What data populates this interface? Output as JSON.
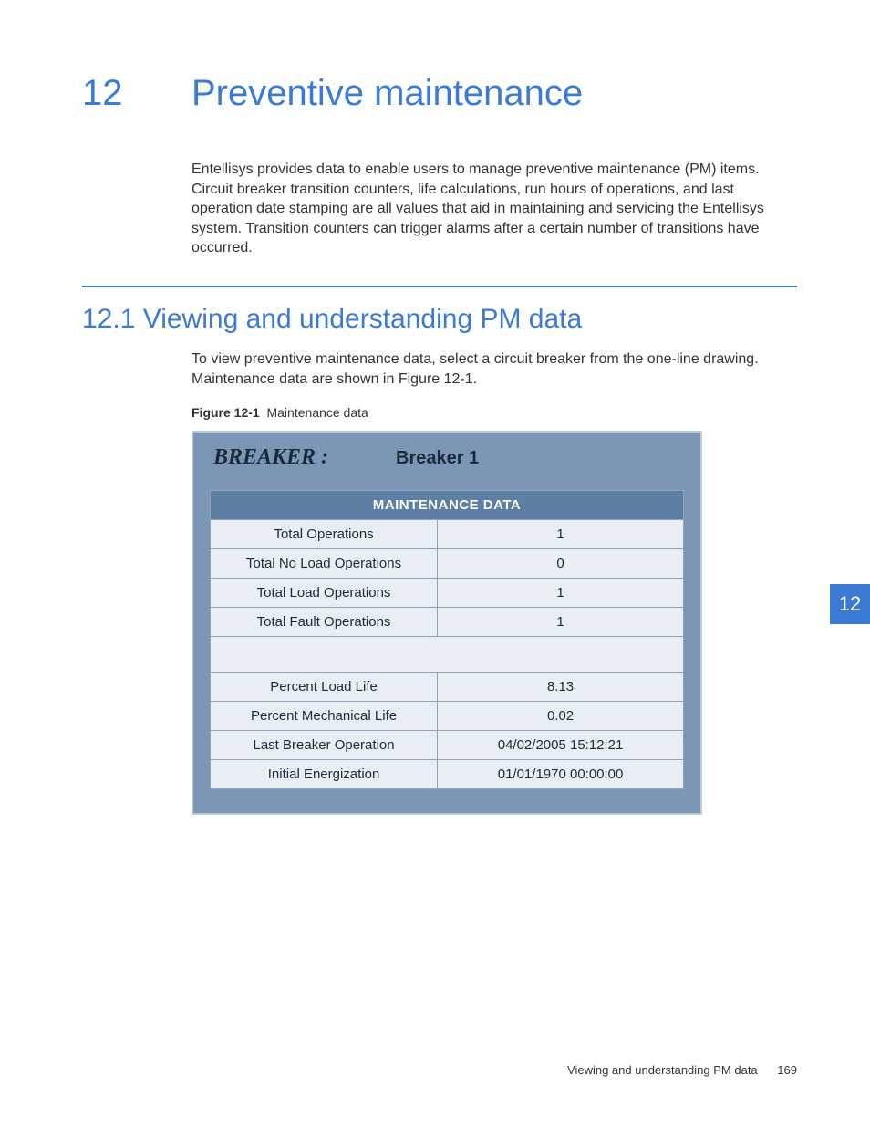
{
  "chapter": {
    "number": "12",
    "title": "Preventive maintenance"
  },
  "intro": "Entellisys provides data to enable users to manage preventive maintenance (PM) items. Circuit breaker transition counters, life calculations, run hours of operations, and last operation date stamping are all values that aid in maintaining and servicing the Entellisys system. Transition counters can trigger alarms after a certain number of transitions have occurred.",
  "section": {
    "number": "12.1",
    "title": "Viewing and understanding PM data",
    "body": "To view preventive maintenance data, select a circuit breaker from the one-line drawing. Maintenance data are shown in Figure 12-1."
  },
  "figure": {
    "label": "Figure 12-1",
    "caption": "Maintenance data"
  },
  "panel": {
    "breaker_label": "BREAKER :",
    "breaker_name": "Breaker 1",
    "table_header": "MAINTENANCE DATA",
    "rows1": [
      {
        "label": "Total Operations",
        "value": "1"
      },
      {
        "label": "Total No Load Operations",
        "value": "0"
      },
      {
        "label": "Total Load Operations",
        "value": "1"
      },
      {
        "label": "Total Fault Operations",
        "value": "1"
      }
    ],
    "rows2": [
      {
        "label": "Percent Load Life",
        "value": "8.13"
      },
      {
        "label": "Percent Mechanical Life",
        "value": "0.02"
      },
      {
        "label": "Last Breaker Operation",
        "value": "04/02/2005 15:12:21"
      },
      {
        "label": "Initial Energization",
        "value": "01/01/1970 00:00:00"
      }
    ]
  },
  "side_tab": "12",
  "footer": {
    "section": "Viewing and understanding PM data",
    "page": "169"
  }
}
